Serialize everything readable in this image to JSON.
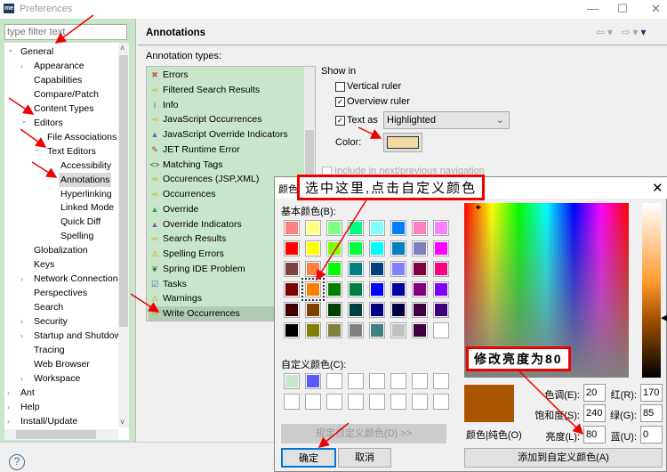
{
  "window": {
    "title": "Preferences",
    "logo": "me"
  },
  "filter": {
    "placeholder": "type filter text"
  },
  "tree": [
    {
      "label": "General",
      "level": 0,
      "expander": "open"
    },
    {
      "label": "Appearance",
      "level": 1,
      "expander": "closed"
    },
    {
      "label": "Capabilities",
      "level": 1,
      "expander": ""
    },
    {
      "label": "Compare/Patch",
      "level": 1,
      "expander": ""
    },
    {
      "label": "Content Types",
      "level": 1,
      "expander": ""
    },
    {
      "label": "Editors",
      "level": 1,
      "expander": "open"
    },
    {
      "label": "File Associations",
      "level": 2,
      "expander": ""
    },
    {
      "label": "Text Editors",
      "level": 2,
      "expander": "open"
    },
    {
      "label": "Accessibility",
      "level": 3,
      "expander": ""
    },
    {
      "label": "Annotations",
      "level": 3,
      "expander": "",
      "selected": true
    },
    {
      "label": "Hyperlinking",
      "level": 3,
      "expander": ""
    },
    {
      "label": "Linked Mode",
      "level": 3,
      "expander": ""
    },
    {
      "label": "Quick Diff",
      "level": 3,
      "expander": ""
    },
    {
      "label": "Spelling",
      "level": 3,
      "expander": ""
    },
    {
      "label": "Globalization",
      "level": 1,
      "expander": ""
    },
    {
      "label": "Keys",
      "level": 1,
      "expander": ""
    },
    {
      "label": "Network Connections",
      "level": 1,
      "expander": "closed"
    },
    {
      "label": "Perspectives",
      "level": 1,
      "expander": ""
    },
    {
      "label": "Search",
      "level": 1,
      "expander": ""
    },
    {
      "label": "Security",
      "level": 1,
      "expander": "closed"
    },
    {
      "label": "Startup and Shutdown",
      "level": 1,
      "expander": "closed"
    },
    {
      "label": "Tracing",
      "level": 1,
      "expander": ""
    },
    {
      "label": "Web Browser",
      "level": 1,
      "expander": ""
    },
    {
      "label": "Workspace",
      "level": 1,
      "expander": "closed"
    },
    {
      "label": "Ant",
      "level": 0,
      "expander": "closed"
    },
    {
      "label": "Help",
      "level": 0,
      "expander": "closed"
    },
    {
      "label": "Install/Update",
      "level": 0,
      "expander": "closed"
    }
  ],
  "main": {
    "title": "Annotations",
    "types_label": "Annotation types:",
    "types": [
      {
        "label": "Errors",
        "icon": "error-icon",
        "glyph": "✖",
        "color": "#d9534f"
      },
      {
        "label": "Filtered Search Results",
        "icon": "arrow-right-icon",
        "glyph": "⇨",
        "color": "#d9a000"
      },
      {
        "label": "Info",
        "icon": "info-icon",
        "glyph": "i",
        "color": "#2a5db0"
      },
      {
        "label": "JavaScript Occurrences",
        "icon": "arrow-right-icon",
        "glyph": "⇨",
        "color": "#d9a000"
      },
      {
        "label": "JavaScript Override Indicators",
        "icon": "triangle-icon",
        "glyph": "▲",
        "color": "#6a5fb0"
      },
      {
        "label": "JET Runtime Error",
        "icon": "jet-error-icon",
        "glyph": "✎",
        "color": "#c03030"
      },
      {
        "label": "Matching Tags",
        "icon": "brackets-icon",
        "glyph": "<>",
        "color": "#333"
      },
      {
        "label": "Occurences (JSP,XML)",
        "icon": "arrow-right-icon",
        "glyph": "⇨",
        "color": "#d9a000"
      },
      {
        "label": "Occurrences",
        "icon": "arrow-right-icon",
        "glyph": "⇨",
        "color": "#d9a000"
      },
      {
        "label": "Override",
        "icon": "triangle-icon",
        "glyph": "▲",
        "color": "#2e9e4e"
      },
      {
        "label": "Override Indicators",
        "icon": "triangle-icon",
        "glyph": "▲",
        "color": "#6a5fb0"
      },
      {
        "label": "Search Results",
        "icon": "arrow-right-icon",
        "glyph": "⇨",
        "color": "#d9a000"
      },
      {
        "label": "Spelling Errors",
        "icon": "warning-icon",
        "glyph": "⚠",
        "color": "#d9a000"
      },
      {
        "label": "Spring IDE Problem",
        "icon": "spring-leaf-icon",
        "glyph": "❦",
        "color": "#3a7a2a"
      },
      {
        "label": "Tasks",
        "icon": "task-icon",
        "glyph": "☑",
        "color": "#3a6ab0"
      },
      {
        "label": "Warnings",
        "icon": "warning-icon",
        "glyph": "⚠",
        "color": "#d9a000"
      },
      {
        "label": "Write Occurrences",
        "icon": "arrow-right-icon",
        "glyph": "⇨",
        "color": "#d9a000",
        "selected": true
      }
    ],
    "show_in": "Show in",
    "vertical_ruler": {
      "label": "Vertical ruler",
      "checked": false
    },
    "overview_ruler": {
      "label": "Overview ruler",
      "checked": true
    },
    "text_as": {
      "label": "Text as",
      "checked": true,
      "value": "Highlighted"
    },
    "color_label": "Color:",
    "color_value": "#f3d9a4",
    "include_nav": "Include in next/previous navigation"
  },
  "dialog": {
    "title": "颜色",
    "basic_label": "基本颜色(B):",
    "custom_label": "自定义颜色(C):",
    "basic_colors": [
      "#ff8080",
      "#ffff80",
      "#80ff80",
      "#00ff80",
      "#80ffff",
      "#0080ff",
      "#ff80c0",
      "#ff80ff",
      "#ff0000",
      "#ffff00",
      "#80ff00",
      "#00ff40",
      "#00ffff",
      "#0080c0",
      "#8080c0",
      "#ff00ff",
      "#804040",
      "#ff8040",
      "#00ff00",
      "#008080",
      "#004080",
      "#8080ff",
      "#800040",
      "#ff0080",
      "#800000",
      "#ff8000",
      "#008000",
      "#008040",
      "#0000ff",
      "#0000a0",
      "#800080",
      "#8000ff",
      "#400000",
      "#804000",
      "#004000",
      "#004040",
      "#000080",
      "#000040",
      "#400040",
      "#400080",
      "#000000",
      "#808000",
      "#808040",
      "#808080",
      "#408080",
      "#c0c0c0",
      "#400040",
      "#ffffff"
    ],
    "selected_index": 25,
    "custom_colors": [
      "#c8e6c9",
      "#5a5aff",
      "#ffffff",
      "#ffffff",
      "#ffffff",
      "#ffffff",
      "#ffffff",
      "#ffffff",
      "#ffffff",
      "#ffffff",
      "#ffffff",
      "#ffffff",
      "#ffffff",
      "#ffffff",
      "#ffffff",
      "#ffffff"
    ],
    "define_custom": "规定自定义颜色(D) >>",
    "ok": "确定",
    "cancel": "取消",
    "preview_color": "#aa5500",
    "preview_label": "颜色|纯色(O)",
    "hue_label": "色调(E):",
    "hue": "20",
    "sat_label": "饱和度(S):",
    "sat": "240",
    "lum_label": "亮度(L):",
    "lum": "80",
    "red_label": "红(R):",
    "red": "170",
    "green_label": "绿(G):",
    "green": "85",
    "blue_label": "蓝(U):",
    "blue": "0",
    "add_custom": "添加到自定义颜色(A)"
  },
  "annotations": {
    "callout1": "选中这里,点击自定义颜色",
    "callout2": "修改亮度为80"
  }
}
